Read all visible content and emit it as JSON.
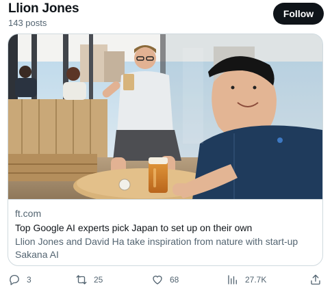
{
  "profile": {
    "name": "Llion Jones",
    "post_count": "143 posts",
    "follow_label": "Follow"
  },
  "card": {
    "domain": "ft.com",
    "title": "Top Google AI experts pick Japan to set up on their own",
    "description": "Llion Jones and David Ha take inspiration from nature with start-up Sakana AI"
  },
  "actions": {
    "replies": "3",
    "reposts": "25",
    "likes": "68",
    "views": "27.7K"
  },
  "icons": {
    "reply": "speech-bubble-icon",
    "repost": "retweet-arrows-icon",
    "like": "heart-icon",
    "views": "bar-chart-icon",
    "share": "share-upload-icon"
  },
  "colors": {
    "text_primary": "#0f1419",
    "text_secondary": "#536471",
    "border": "#cfd9de",
    "button_bg": "#0f1419"
  }
}
